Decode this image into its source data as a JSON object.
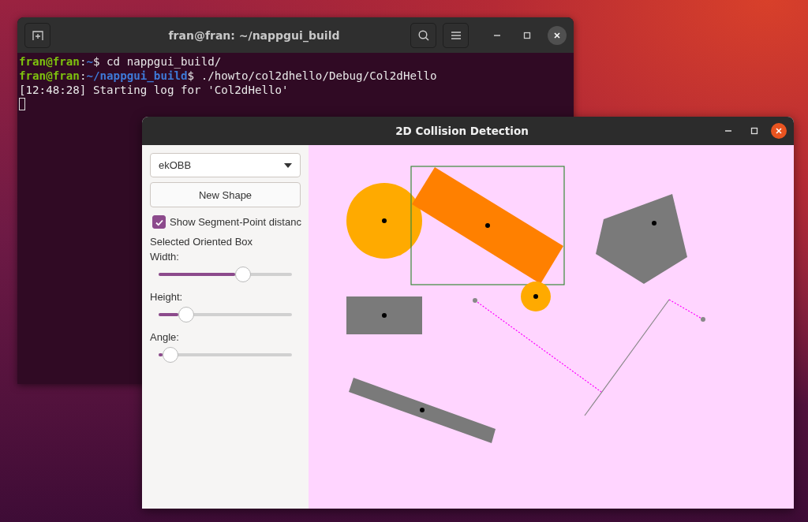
{
  "terminal": {
    "title": "fran@fran: ~/nappgui_build",
    "lines": [
      {
        "kind": "prompt",
        "user": "fran@fran",
        "sep": ":",
        "path": "~",
        "symbol": "$",
        "command": "cd nappgui_build/"
      },
      {
        "kind": "prompt",
        "user": "fran@fran",
        "sep": ":",
        "path": "~/nappgui_build",
        "symbol": "$",
        "command": "./howto/col2dhello/Debug/Col2dHello"
      },
      {
        "kind": "output",
        "text": "[12:48:28] Starting log for 'Col2dHello'"
      }
    ]
  },
  "app_window": {
    "title": "2D Collision Detection",
    "shape_type": "ekOBB",
    "new_shape_button": "New Shape",
    "show_distance": {
      "label": "Show Segment-Point distanc",
      "checked": true
    },
    "section_label": "Selected Oriented Box",
    "sliders": [
      {
        "label": "Width:",
        "level": 0.63
      },
      {
        "label": "Height:",
        "level": 0.2
      },
      {
        "label": "Angle:",
        "level": 0.08
      }
    ]
  }
}
